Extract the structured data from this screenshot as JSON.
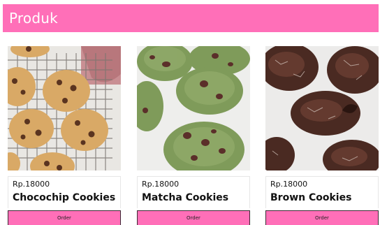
{
  "header": {
    "title": "Produk"
  },
  "products": [
    {
      "price": "Rp.18000",
      "name": "Chocochip Cookies",
      "order_label": "Order",
      "image": "chocochip-cookies-photo"
    },
    {
      "price": "Rp.18000",
      "name": "Matcha Cookies",
      "order_label": "Order",
      "image": "matcha-cookies-photo"
    },
    {
      "price": "Rp.18000",
      "name": "Brown Cookies",
      "order_label": "Order",
      "image": "brown-cookies-photo"
    }
  ],
  "colors": {
    "accent": "#ff6fb8",
    "text": "#111111"
  }
}
